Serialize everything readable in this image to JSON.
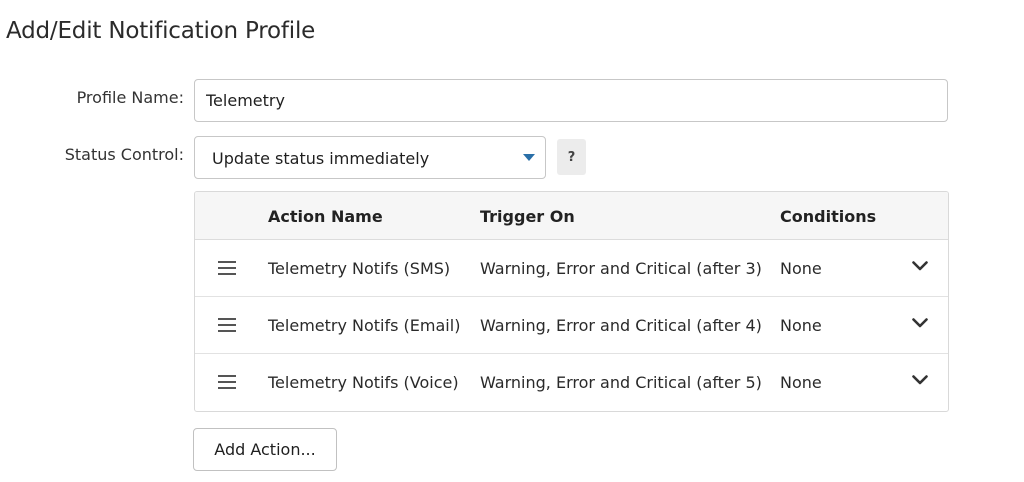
{
  "page": {
    "title": "Add/Edit Notification Profile"
  },
  "form": {
    "profile_name_label": "Profile Name:",
    "profile_name_value": "Telemetry",
    "status_control_label": "Status Control:",
    "status_control_value": "Update status immediately",
    "help_label": "?"
  },
  "actions_table": {
    "headers": {
      "name": "Action Name",
      "trigger": "Trigger On",
      "conditions": "Conditions"
    },
    "rows": [
      {
        "name": "Telemetry Notifs (SMS)",
        "trigger": "Warning, Error and Critical (after 3)",
        "conditions": "None"
      },
      {
        "name": "Telemetry Notifs (Email)",
        "trigger": "Warning, Error and Critical (after 4)",
        "conditions": "None"
      },
      {
        "name": "Telemetry Notifs (Voice)",
        "trigger": "Warning, Error and Critical (after 5)",
        "conditions": "None"
      }
    ]
  },
  "buttons": {
    "add_action": "Add Action..."
  },
  "icons": {
    "drag_handle": "drag-handle-icon",
    "expand": "chevron-down-icon",
    "select_caret": "caret-down-icon"
  },
  "colors": {
    "caret": "#2a6fa8"
  }
}
